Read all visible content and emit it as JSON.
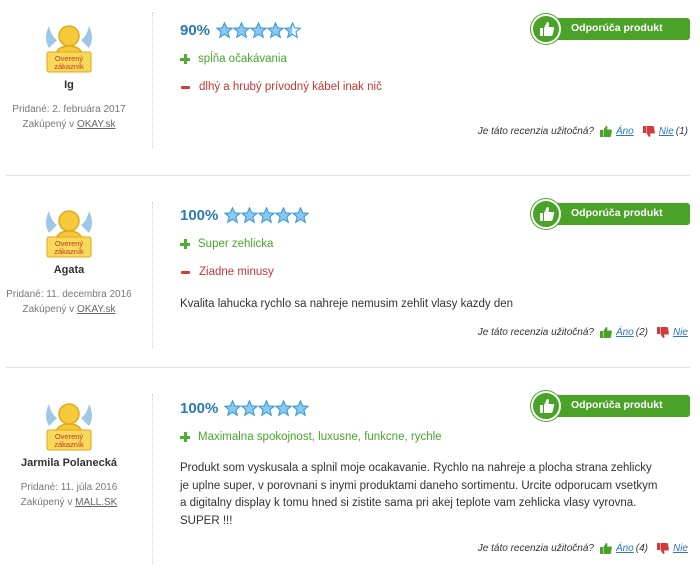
{
  "badge_text": {
    "line1": "Overený",
    "line2": "zákazník"
  },
  "recommend_label": "Odporúča produkt",
  "useful_question": "Je táto recenzia užitočná?",
  "yes_label": "Áno",
  "no_label": "Nie",
  "colors": {
    "accent_green": "#4aa228",
    "blue": "#2b79b5",
    "red": "#c03a36",
    "star": "#3aa0e0"
  },
  "reviews": [
    {
      "name": "Ig",
      "date": "Pridané: 2. februára 2017",
      "shop_prefix": "Zakúpený v",
      "shop": "OKAY.sk",
      "percent": "90%",
      "stars_value": 4.5,
      "pros": [
        "spĺňa očakávania"
      ],
      "cons": [
        "dlhý a hrubý prívodný kábel inak nič"
      ],
      "text": "",
      "yes_count": "",
      "no_count": "(1)"
    },
    {
      "name": "Agata",
      "date": "Pridané: 11. decembra 2016",
      "shop_prefix": "Zakúpený v",
      "shop": "OKAY.sk",
      "percent": "100%",
      "stars_value": 5,
      "pros": [
        "Super zehlicka"
      ],
      "cons": [
        "Ziadne minusy"
      ],
      "text": "Kvalita lahucka rychlo sa nahreje nemusim zehlit vlasy kazdy den",
      "yes_count": "(2)",
      "no_count": ""
    },
    {
      "name": "Jarmila Polanecká",
      "date": "Pridané: 11. júla 2016",
      "shop_prefix": "Zakúpený v",
      "shop": "MALL.SK",
      "percent": "100%",
      "stars_value": 5,
      "pros": [
        "Maximalna spokojnost, luxusne, funkcne, rychle"
      ],
      "cons": [],
      "text_lines": [
        "Produkt som vyskusala a splnil moje ocakavanie. Rychlo na nahreje a plocha strana zehlicky",
        "je uplne super, v porovnani s inymi produktami daneho sortimentu. Urcite odporucam vsetkym",
        "a digitalny display k tomu hned si zistite sama pri akej teplote vam zehlicka vlasy vyrovna.",
        "SUPER !!!"
      ],
      "yes_count": "(4)",
      "no_count": ""
    }
  ]
}
